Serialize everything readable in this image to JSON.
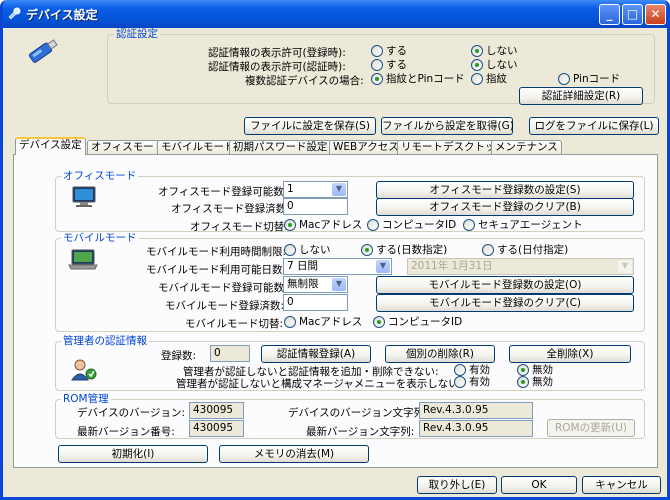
{
  "window": {
    "title": "デバイス設定",
    "minimize": "_",
    "maximize": "□",
    "close": "✕"
  },
  "auth": {
    "legend": "認証設定",
    "row1": {
      "label": "認証情報の表示許可(登録時):",
      "opt1": "する",
      "opt2": "しない",
      "selected": "しない"
    },
    "row2": {
      "label": "認証情報の表示許可(認証時):",
      "opt1": "する",
      "opt2": "しない",
      "selected": "しない"
    },
    "row3": {
      "label": "複数認証デバイスの場合:",
      "opt1": "指紋とPinコード",
      "opt2": "指紋",
      "opt3": "Pinコード",
      "selected": "指紋とPinコード"
    },
    "detail_button": "認証詳細設定(R)"
  },
  "top_buttons": {
    "save_file": "ファイルに設定を保存(S)",
    "load_file": "ファイルから設定を取得(G)",
    "save_log": "ログをファイルに保存(L)"
  },
  "tabs": [
    "デバイス設定",
    "オフィスモード",
    "モバイルモード",
    "初期パスワード設定",
    "WEBアクセス",
    "リモートデスクトップ",
    "メンテナンス"
  ],
  "active_tab": "デバイス設定",
  "office": {
    "legend": "オフィスモード",
    "count_label": "オフィスモード登録可能数:",
    "count_value": "1",
    "done_label": "オフィスモード登録済数:",
    "done_value": "0",
    "switch_label": "オフィスモード切替:",
    "opt1": "Macアドレス",
    "opt2": "コンピュータID",
    "opt3": "セキュアエージェント",
    "selected": "Macアドレス",
    "set_button": "オフィスモード登録数の設定(S)",
    "clear_button": "オフィスモード登録のクリア(B)"
  },
  "mobile": {
    "legend": "モバイルモード",
    "limit_label": "モバイルモード利用時間制限:",
    "opt_none": "しない",
    "opt_days": "する(日数指定)",
    "opt_date": "する(日付指定)",
    "limit_selected": "する(日数指定)",
    "days_label": "モバイルモード利用可能日数:",
    "days_value": "7 日間",
    "date_value": "2011年 1月31日",
    "count_label": "モバイルモード登録可能数:",
    "count_value": "無制限",
    "done_label": "モバイルモード登録済数:",
    "done_value": "0",
    "switch_label": "モバイルモード切替:",
    "sw1": "Macアドレス",
    "sw2": "コンピュータID",
    "sw_selected": "コンピュータID",
    "set_button": "モバイルモード登録数の設定(O)",
    "clear_button": "モバイルモード登録のクリア(C)"
  },
  "admin": {
    "legend": "管理者の認証情報",
    "count_label": "登録数:",
    "count_value": "0",
    "register_button": "認証情報登録(A)",
    "delete_button": "個別の削除(R)",
    "delete_all_button": "全削除(X)",
    "row1_label": "管理者が認証しないと認証情報を追加・削除できない:",
    "row2_label": "管理者が認証しないと構成マネージャメニューを表示しない:",
    "opt_on": "有効",
    "opt_off": "無効",
    "row1_selected": "無効",
    "row2_selected": "無効"
  },
  "rom": {
    "legend": "ROM管理",
    "dev_ver_label": "デバイスのバージョン:",
    "dev_ver": "430095",
    "latest_ver_label": "最新バージョン番号:",
    "latest_ver": "430095",
    "dev_str_label": "デバイスのバージョン文字列:",
    "dev_str": "Rev.4.3.0.95",
    "latest_str_label": "最新バージョン文字列:",
    "latest_str": "Rev.4.3.0.95",
    "update_button": "ROMの更新(U)"
  },
  "bottom": {
    "init_button": "初期化(I)",
    "erase_button": "メモリの消去(M)",
    "detach_button": "取り外し(E)",
    "ok_button": "OK",
    "cancel_button": "キャンセル"
  },
  "colors": {
    "title_bar": "#0553d6",
    "group_label": "#0046d5",
    "radio_on": "#21a121"
  }
}
